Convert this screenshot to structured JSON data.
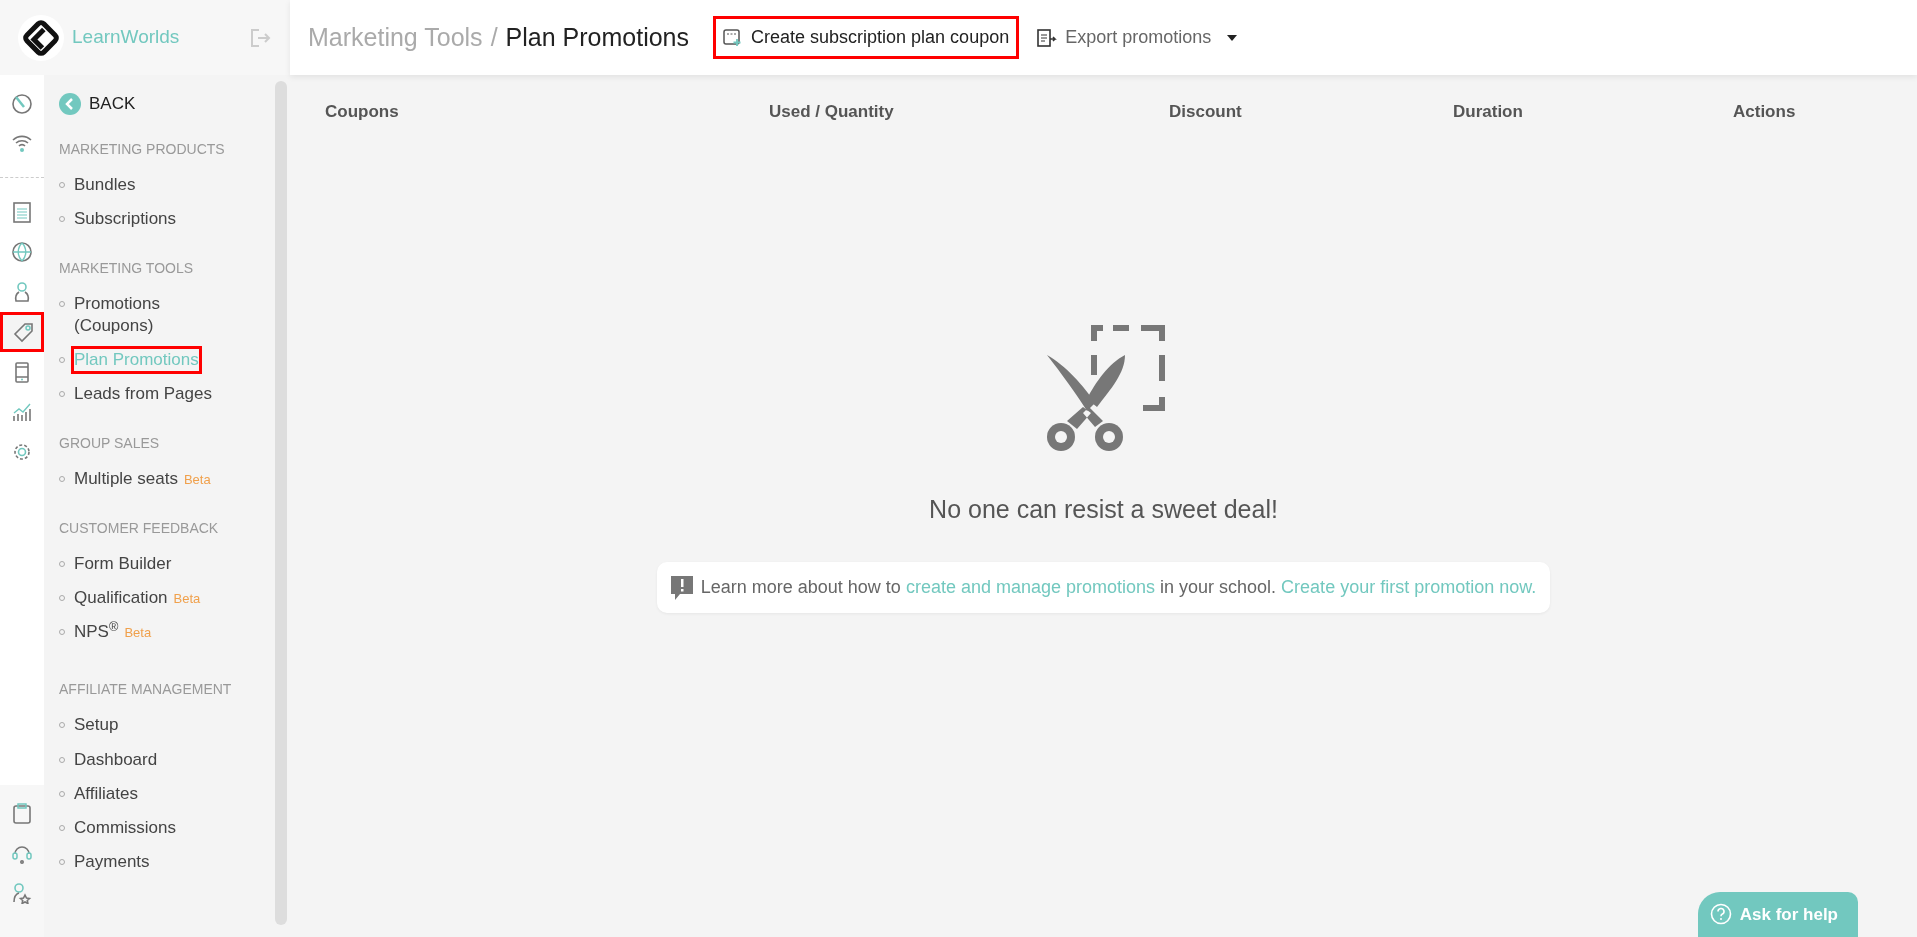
{
  "brand": {
    "name": "LearnWorlds"
  },
  "rail": {
    "top": [
      {
        "selected": false,
        "highlighted": false
      },
      {
        "selected": false,
        "highlighted": false
      }
    ],
    "middle": [
      {
        "selected": false,
        "highlighted": false
      },
      {
        "selected": false,
        "highlighted": false
      },
      {
        "selected": false,
        "highlighted": false
      },
      {
        "selected": true,
        "highlighted": true
      },
      {
        "selected": false,
        "highlighted": false
      },
      {
        "selected": false,
        "highlighted": false
      },
      {
        "selected": false,
        "highlighted": false
      }
    ],
    "bottom": [
      {
        "selected": false,
        "highlighted": false
      },
      {
        "selected": false,
        "highlighted": false
      },
      {
        "selected": false,
        "highlighted": false
      }
    ]
  },
  "sidebar": {
    "back": "BACK",
    "sections": [
      {
        "title": "MARKETING PRODUCTS",
        "items": [
          {
            "label": "Bundles",
            "selected": false,
            "highlighted": false
          },
          {
            "label": "Subscriptions",
            "selected": false,
            "highlighted": false
          }
        ]
      },
      {
        "title": "MARKETING TOOLS",
        "items": [
          {
            "label": "Promotions (Coupons)",
            "selected": false,
            "highlighted": false
          },
          {
            "label": "Plan Promotions",
            "selected": true,
            "highlighted": true
          },
          {
            "label": "Leads from Pages",
            "selected": false,
            "highlighted": false
          }
        ]
      },
      {
        "title": "GROUP SALES",
        "items": [
          {
            "label": "Multiple seats",
            "badge": "Beta",
            "selected": false,
            "highlighted": false
          }
        ]
      },
      {
        "title": "CUSTOMER FEEDBACK",
        "items": [
          {
            "label": "Form Builder",
            "selected": false,
            "highlighted": false
          },
          {
            "label": "Qualification",
            "badge": "Beta",
            "selected": false,
            "highlighted": false
          },
          {
            "label": "NPS$^{®}$",
            "badge": "Beta",
            "selected": false,
            "highlighted": false
          }
        ]
      },
      {
        "title": "AFFILIATE MANAGEMENT",
        "items": [
          {
            "label": "Setup",
            "selected": false,
            "highlighted": false
          },
          {
            "label": "Dashboard",
            "selected": false,
            "highlighted": false
          },
          {
            "label": "Affiliates",
            "selected": false,
            "highlighted": false
          },
          {
            "label": "Commissions",
            "selected": false,
            "highlighted": false
          },
          {
            "label": "Payments",
            "selected": false,
            "highlighted": false
          }
        ]
      }
    ]
  },
  "header": {
    "breadcrumb": {
      "parent": "Marketing Tools",
      "separator": "/",
      "current": "Plan Promotions"
    },
    "actions": [
      {
        "kind": "button",
        "label": "Create subscription plan coupon",
        "highlighted": true
      },
      {
        "kind": "dropdown",
        "label": "Export promotions",
        "highlighted": false
      }
    ]
  },
  "table": {
    "columns": [
      "Coupons",
      "Used / Quantity",
      "Discount",
      "Duration",
      "Actions"
    ]
  },
  "empty_state": {
    "message": "No one can resist a sweet deal!",
    "info": [
      {
        "kind": "text",
        "text": "Learn more about how to "
      },
      {
        "kind": "link",
        "text": "create and manage promotions"
      },
      {
        "kind": "text",
        "text": " in your school. "
      },
      {
        "kind": "link",
        "text": "Create your first promotion now."
      }
    ]
  },
  "help_button": {
    "label": "Ask for help"
  }
}
